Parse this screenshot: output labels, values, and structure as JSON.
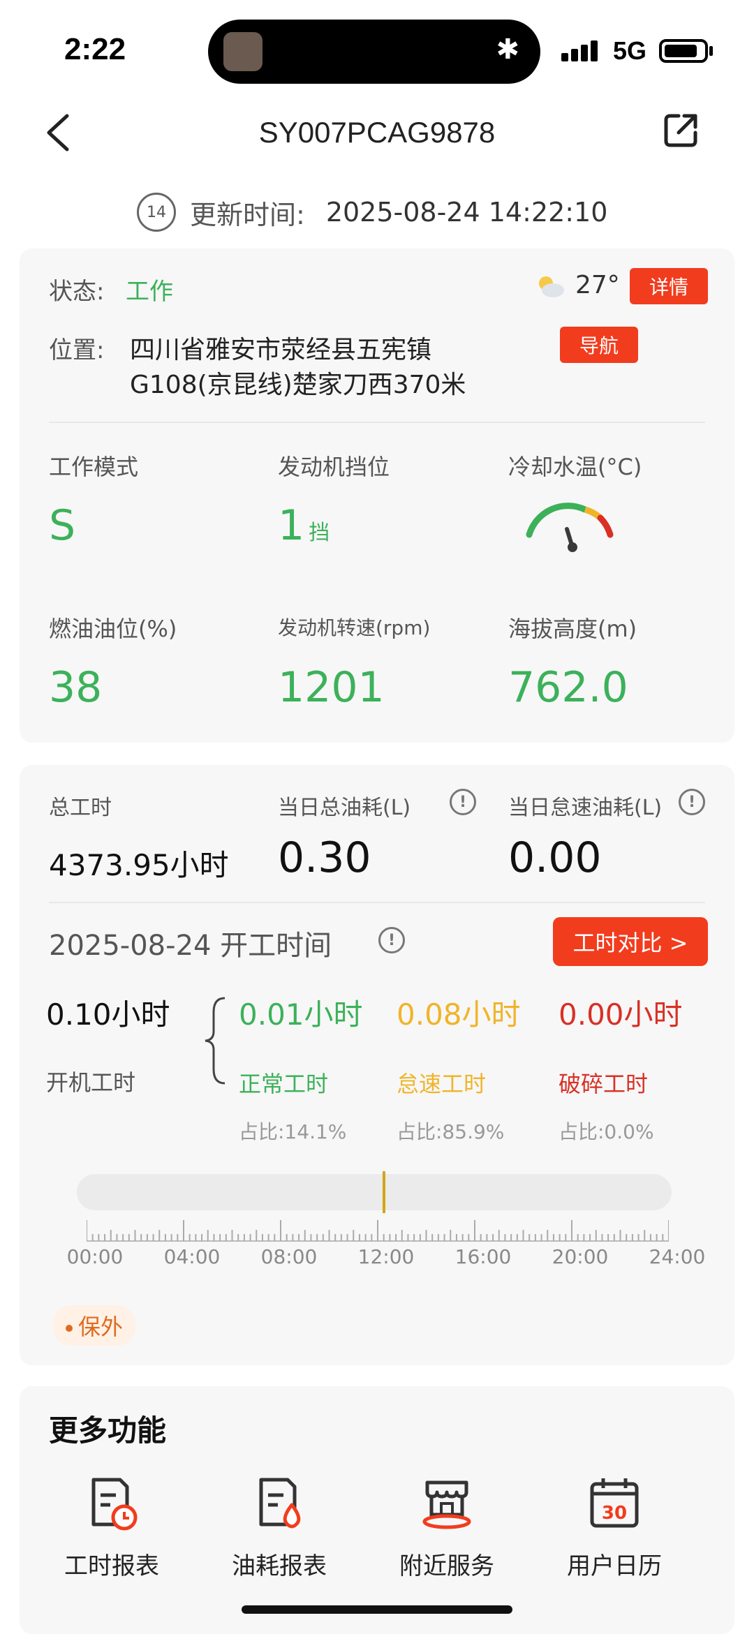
{
  "status_bar": {
    "time": "2:22",
    "network": "5G"
  },
  "header": {
    "title": "SY007PCAG9878"
  },
  "update": {
    "badge": "14",
    "label": "更新时间:",
    "value": "2025-08-24  14:22:10"
  },
  "status_card": {
    "status_label": "状态:",
    "status_value": "工作",
    "weather_temp": "27°",
    "detail_button": "详情",
    "location_label": "位置:",
    "location_line1": "四川省雅安市荥经县五宪镇",
    "location_line2": "G108(京昆线)楚家刀西370米",
    "nav_button": "导航",
    "metrics": [
      {
        "label": "工作模式",
        "value": "S"
      },
      {
        "label": "发动机挡位",
        "value": "1",
        "unit": "挡"
      },
      {
        "label": "冷却水温(°C)"
      },
      {
        "label": "燃油油位(%)",
        "value": "38"
      },
      {
        "label": "发动机转速(rpm)",
        "value": "1201"
      },
      {
        "label": "海拔高度(m)",
        "value": "762.0"
      }
    ]
  },
  "work_card": {
    "total_hours_label": "总工时",
    "total_hours_value": "4373.95小时",
    "day_fuel_label": "当日总油耗(L)",
    "day_fuel_value": "0.30",
    "idle_fuel_label": "当日怠速油耗(L)",
    "idle_fuel_value": "0.00",
    "date_title": "2025-08-24 开工时间",
    "compare_button": "工时对比 >",
    "on_hours_value": "0.10小时",
    "on_hours_label": "开机工时",
    "breakdown": [
      {
        "value": "0.01小时",
        "label": "正常工时",
        "ratio": "占比:14.1%",
        "color": "#3cb15a"
      },
      {
        "value": "0.08小时",
        "label": "怠速工时",
        "ratio": "占比:85.9%",
        "color": "#f0b429"
      },
      {
        "value": "0.00小时",
        "label": "破碎工时",
        "ratio": "占比:0.0%",
        "color": "#d93025"
      }
    ],
    "timeline_ticks": [
      "00:00",
      "04:00",
      "08:00",
      "12:00",
      "16:00",
      "20:00",
      "24:00"
    ],
    "warranty_tag": "保外"
  },
  "more": {
    "title": "更多功能",
    "items": [
      {
        "label": "工时报表",
        "icon": "hours-report-icon"
      },
      {
        "label": "油耗报表",
        "icon": "fuel-report-icon"
      },
      {
        "label": "附近服务",
        "icon": "nearby-service-icon"
      },
      {
        "label": "用户日历",
        "icon": "calendar-icon",
        "badge": "30"
      }
    ]
  }
}
